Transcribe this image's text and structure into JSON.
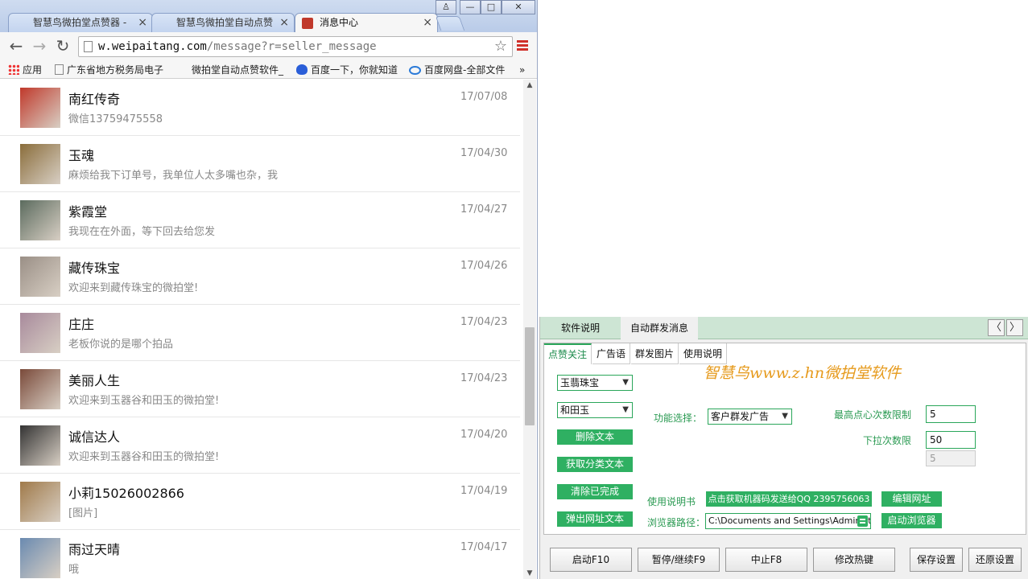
{
  "browser": {
    "tabs": [
      {
        "title": "智慧鸟微拍堂点赞器 -",
        "close": "×"
      },
      {
        "title": "智慧鸟微拍堂自动点赞",
        "close": "×"
      },
      {
        "title": "消息中心",
        "close": "×"
      }
    ],
    "window_controls": {
      "user": "♙",
      "minimize": "—",
      "maximize": "□",
      "close": "✕"
    },
    "nav": {
      "back": "←",
      "forward": "→",
      "reload": "↻"
    },
    "url": {
      "host": "w.weipaitang.com",
      "path": "/message?r=seller_message",
      "star": "☆"
    },
    "bookmarks": [
      {
        "label": "应用",
        "icon": "apps-icon"
      },
      {
        "label": "广东省地方税务局电子",
        "icon": "page-icon"
      },
      {
        "label": "微拍堂自动点赞软件_",
        "icon": "none"
      },
      {
        "label": "百度一下，你就知道",
        "icon": "baidu-icon"
      },
      {
        "label": "百度网盘-全部文件",
        "icon": "baidu-pan-icon"
      }
    ],
    "bookmarks_more": "»"
  },
  "messages": [
    {
      "name": "南红传奇",
      "date": "17/07/08",
      "text": "微信13759475558",
      "avatar_color": "#c0392b"
    },
    {
      "name": "玉魂",
      "date": "17/04/30",
      "text": "麻烦给我下订单号，我单位人太多嘴也杂，我",
      "avatar_color": "#8a6d3b"
    },
    {
      "name": "紫霞堂",
      "date": "17/04/27",
      "text": "我现在在外面，等下回去给您发",
      "avatar_color": "#5b6b5e"
    },
    {
      "name": "藏传珠宝",
      "date": "17/04/26",
      "text": "欢迎来到藏传珠宝的微拍堂!",
      "avatar_color": "#9a8f86"
    },
    {
      "name": "庄庄",
      "date": "17/04/23",
      "text": "老板你说的是哪个拍品",
      "avatar_color": "#a88a9c"
    },
    {
      "name": "美丽人生",
      "date": "17/04/23",
      "text": "欢迎来到玉器谷和田玉的微拍堂!",
      "avatar_color": "#7a4a3a"
    },
    {
      "name": "诚信达人",
      "date": "17/04/20",
      "text": "欢迎来到玉器谷和田玉的微拍堂!",
      "avatar_color": "#333333"
    },
    {
      "name": "小莉15026002866",
      "date": "17/04/19",
      "text": "[图片]",
      "avatar_color": "#a07a4a"
    },
    {
      "name": "雨过天晴",
      "date": "17/04/17",
      "text": "哦",
      "avatar_color": "#6a8ab0"
    }
  ],
  "scroll": {
    "up": "▲",
    "down": "▼"
  },
  "panel": {
    "top_tabs": [
      "软件说明",
      "自动群发消息"
    ],
    "arrows": {
      "left": "〈",
      "right": "〉"
    },
    "sub_tabs": [
      "点赞关注",
      "广告语",
      "群发图片",
      "使用说明"
    ],
    "brand": "智慧鸟www.z.hn微拍堂软件",
    "combo1": "玉翡珠宝",
    "combo2": "和田玉",
    "combo_arrow": "▼",
    "buttons_left": [
      "删除文本",
      "获取分类文本",
      "清除已完成",
      "弹出网址文本"
    ],
    "func_label": "功能选择：",
    "func_value": "客户群发广告",
    "max_likes_label": "最高点心次数限制",
    "max_likes_value": "5",
    "pull_label": "下拉次数限",
    "pull_value": "50",
    "disabled_value": "5",
    "manual_label": "使用说明书",
    "machine_code_btn": "点击获取机器码发送给QQ 2395756063",
    "edit_url_btn": "编辑网址",
    "browser_path_label": "浏览器路径：",
    "browser_path_value": "C:\\Documents and Settings\\Administrator",
    "launch_browser_btn": "启动浏览器",
    "bottom_buttons": [
      "启动F10",
      "暂停/继续F9",
      "中止F8",
      "修改热键",
      "保存设置",
      "还原设置"
    ]
  },
  "colors": {
    "accent_green": "#2fb062",
    "brand_orange": "#e69a1c",
    "tab_green_bg": "#cde5d4"
  }
}
